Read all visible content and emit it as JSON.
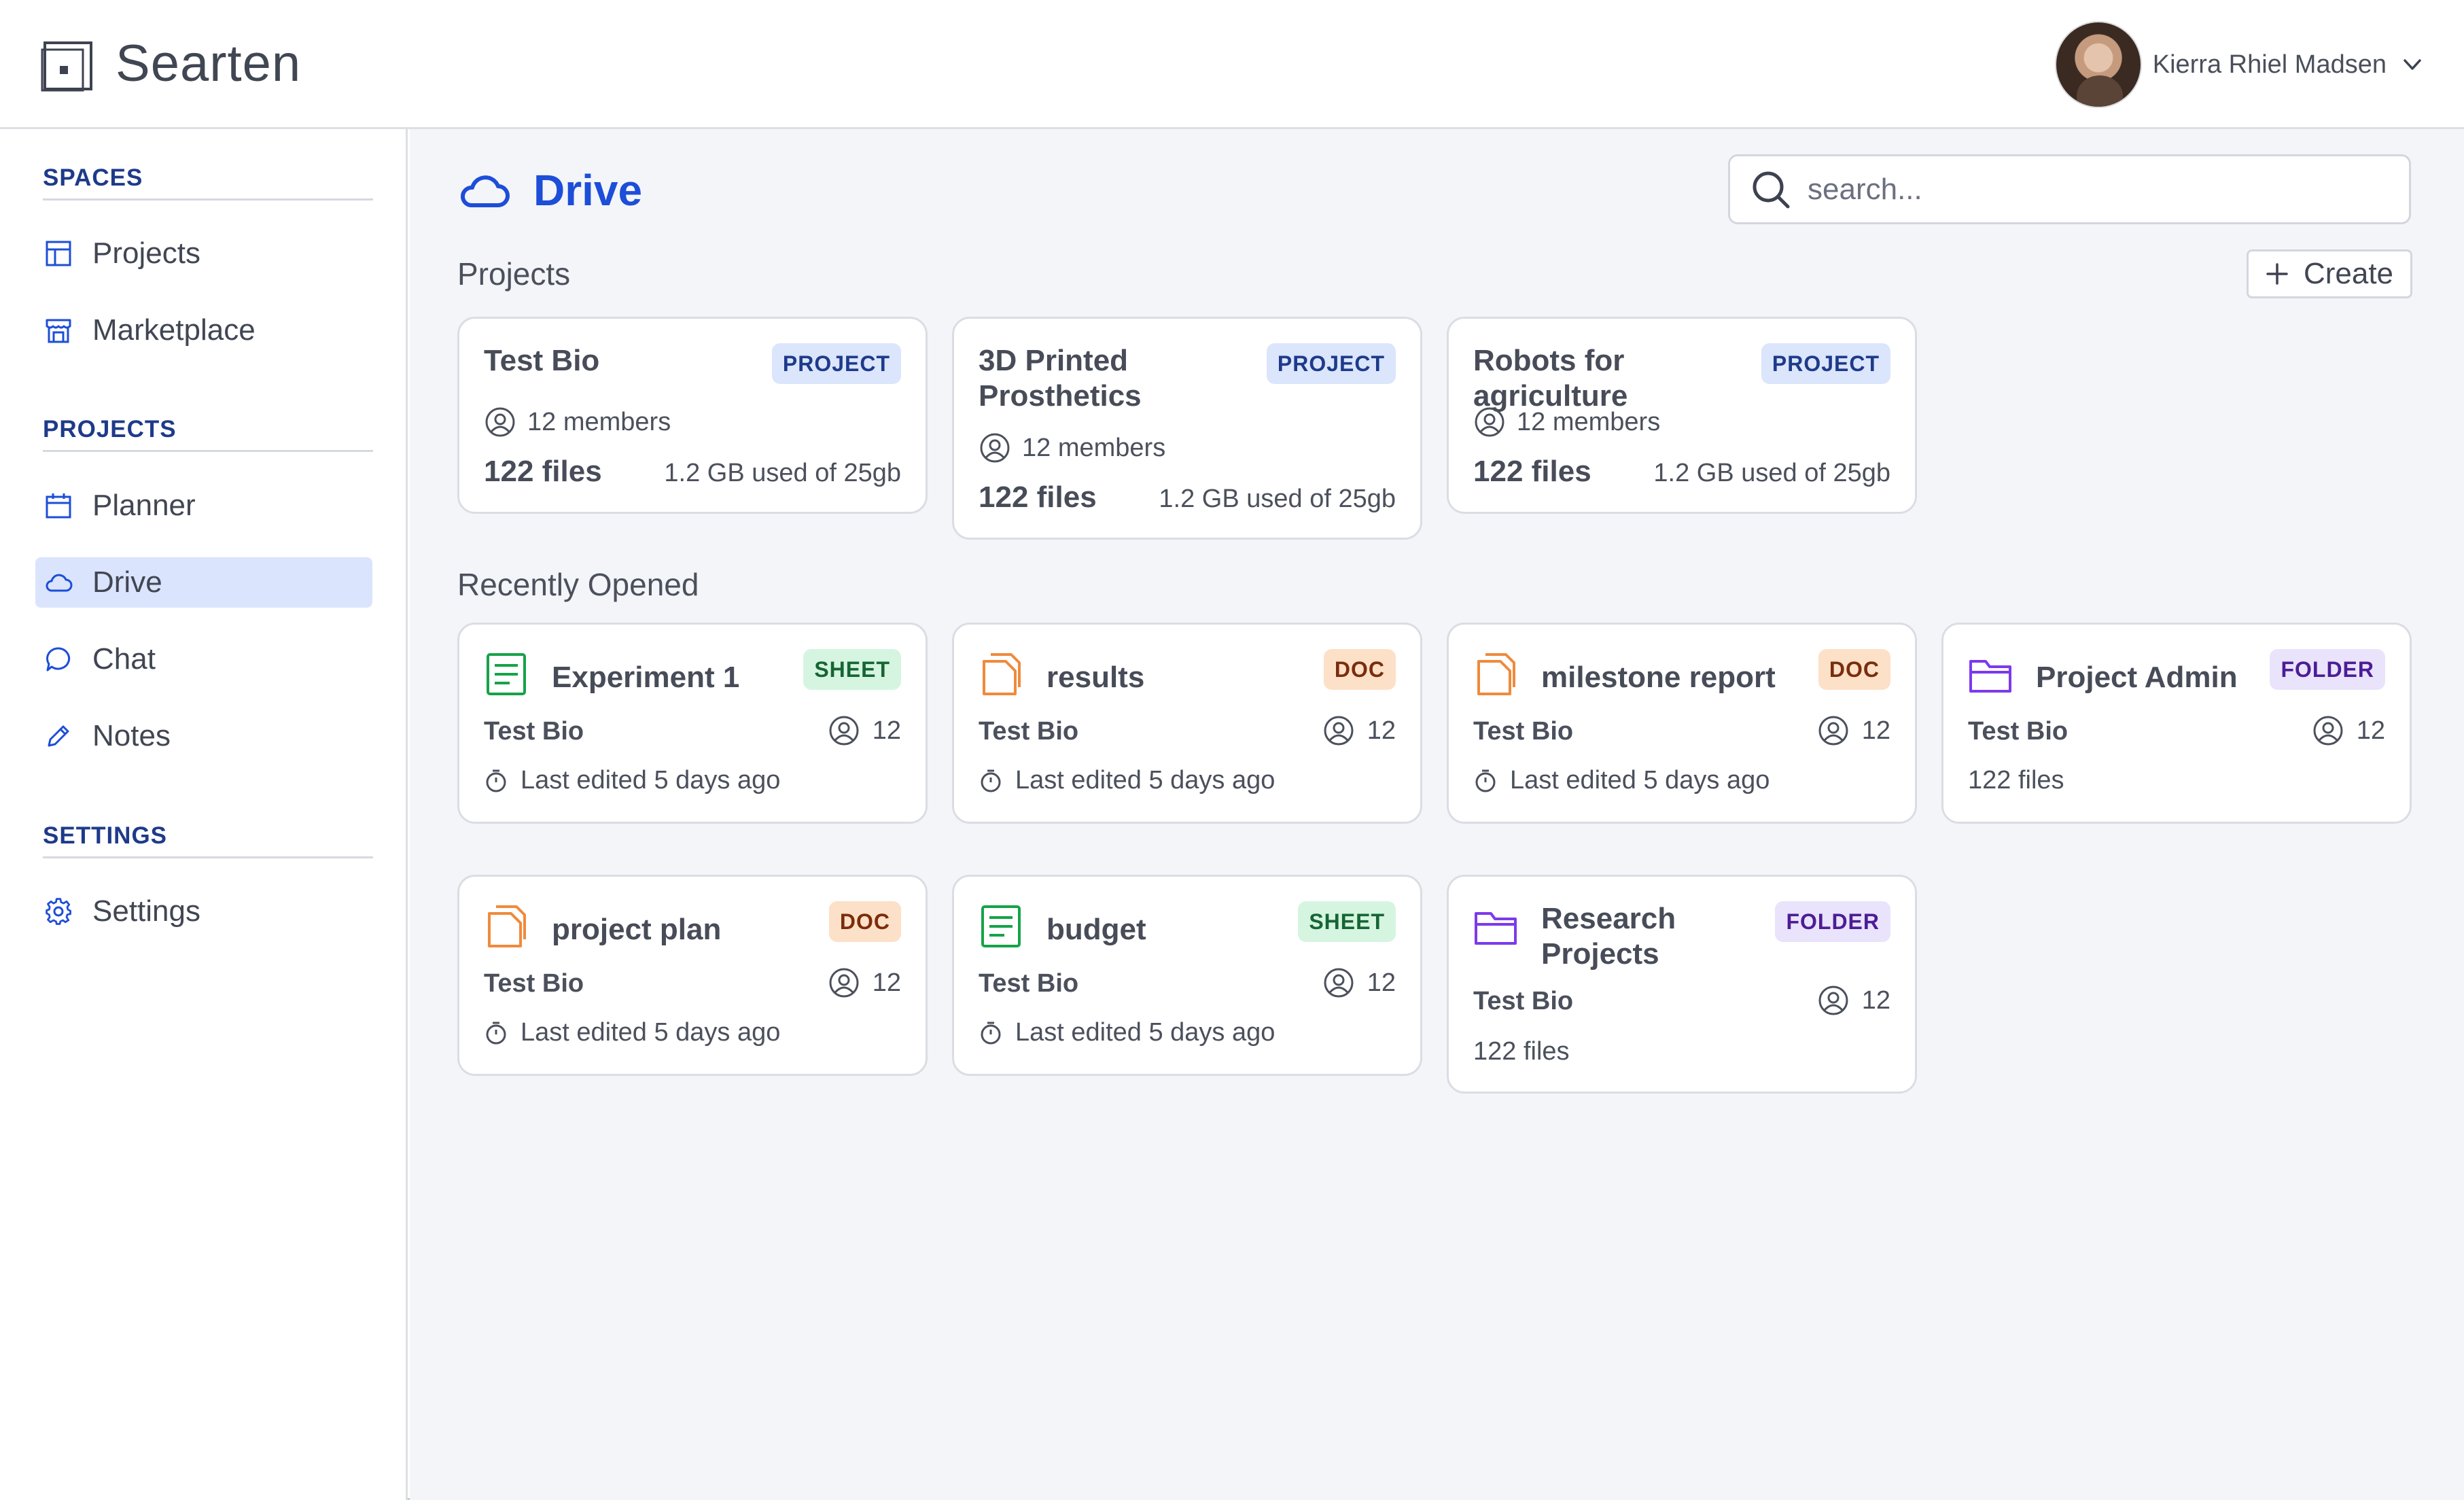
{
  "app": {
    "name": "Searten"
  },
  "user": {
    "name": "Kierra Rhiel Madsen"
  },
  "sidebar": {
    "sections": [
      {
        "title": "SPACES",
        "items": [
          {
            "label": "Projects",
            "icon": "layout-icon"
          },
          {
            "label": "Marketplace",
            "icon": "store-icon"
          }
        ]
      },
      {
        "title": "PROJECTS",
        "items": [
          {
            "label": "Planner",
            "icon": "calendar-icon"
          },
          {
            "label": "Drive",
            "icon": "cloud-icon",
            "active": true
          },
          {
            "label": "Chat",
            "icon": "chat-icon"
          },
          {
            "label": "Notes",
            "icon": "pencil-icon"
          }
        ]
      },
      {
        "title": "SETTINGS",
        "items": [
          {
            "label": "Settings",
            "icon": "gear-icon"
          }
        ]
      }
    ]
  },
  "main": {
    "title": "Drive",
    "search": {
      "placeholder": "search..."
    },
    "projects_label": "Projects",
    "create_label": "Create",
    "projects": [
      {
        "name": "Test Bio",
        "badge": "PROJECT",
        "members": "12 members",
        "files": "122 files",
        "storage": "1.2 GB used of 25gb"
      },
      {
        "name": "3D Printed Prosthetics",
        "badge": "PROJECT",
        "members": "12 members",
        "files": "122 files",
        "storage": "1.2 GB used of 25gb"
      },
      {
        "name": "Robots for agriculture",
        "badge": "PROJECT",
        "members": "12 members",
        "files": "122 files",
        "storage": "1.2 GB used of 25gb"
      }
    ],
    "recent_label": "Recently Opened",
    "recent": [
      {
        "name": "Experiment 1",
        "badge": "SHEET",
        "owner": "Test Bio",
        "count": "12",
        "detail": "Last edited 5 days ago"
      },
      {
        "name": "results",
        "badge": "DOC",
        "owner": "Test Bio",
        "count": "12",
        "detail": "Last edited 5 days ago"
      },
      {
        "name": "milestone report",
        "badge": "DOC",
        "owner": "Test Bio",
        "count": "12",
        "detail": "Last edited 5 days ago"
      },
      {
        "name": "Project Admin",
        "badge": "FOLDER",
        "owner": "Test Bio",
        "count": "12",
        "detail": "122 files"
      },
      {
        "name": "project plan",
        "badge": "DOC",
        "owner": "Test Bio",
        "count": "12",
        "detail": "Last edited 5 days ago"
      },
      {
        "name": "budget",
        "badge": "SHEET",
        "owner": "Test Bio",
        "count": "12",
        "detail": "Last edited 5 days ago"
      },
      {
        "name": "Research Projects",
        "badge": "FOLDER",
        "owner": "Test Bio",
        "count": "12",
        "detail": "122 files"
      }
    ]
  },
  "colors": {
    "accent": "#1d4ed8",
    "sheet": "#16a34a",
    "doc": "#f08a3c",
    "folder": "#7c3aed",
    "active_nav": "#dbe4fd"
  }
}
